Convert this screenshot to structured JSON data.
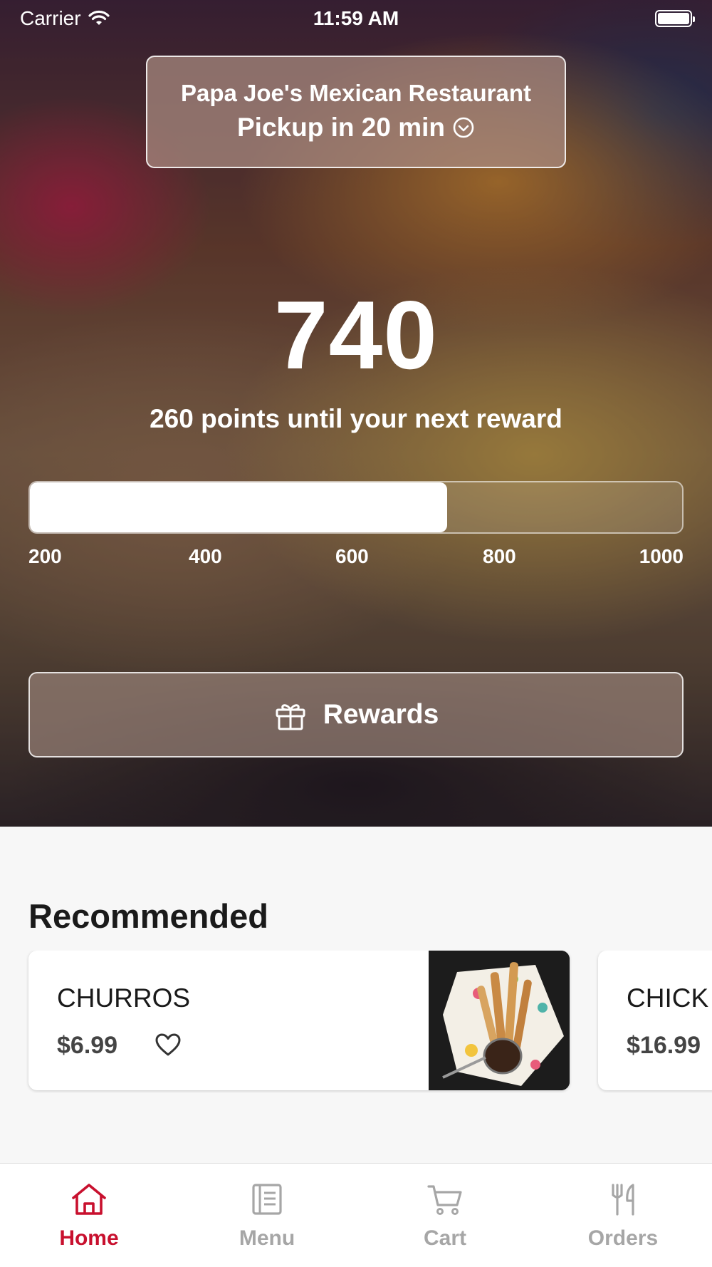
{
  "status_bar": {
    "carrier": "Carrier",
    "time": "11:59 AM"
  },
  "location": {
    "name": "Papa Joe's Mexican Restaurant",
    "pickup": "Pickup in 20 min"
  },
  "points": {
    "value": "740",
    "caption": "260 points until your next reward",
    "progress_fraction": 0.64,
    "scale_labels": [
      "200",
      "400",
      "600",
      "800",
      "1000"
    ]
  },
  "rewards_button": {
    "label": "Rewards"
  },
  "recommended": {
    "title": "Recommended",
    "items": [
      {
        "name": "CHURROS",
        "price": "$6.99"
      },
      {
        "name": "CHICK",
        "price": "$16.99"
      }
    ]
  },
  "tab_bar": {
    "tabs": [
      {
        "label": "Home",
        "icon": "home-icon",
        "active": true
      },
      {
        "label": "Menu",
        "icon": "menu-icon",
        "active": false
      },
      {
        "label": "Cart",
        "icon": "cart-icon",
        "active": false
      },
      {
        "label": "Orders",
        "icon": "orders-icon",
        "active": false
      }
    ]
  },
  "colors": {
    "accent": "#c8102e",
    "inactive": "#a6a6a6"
  }
}
